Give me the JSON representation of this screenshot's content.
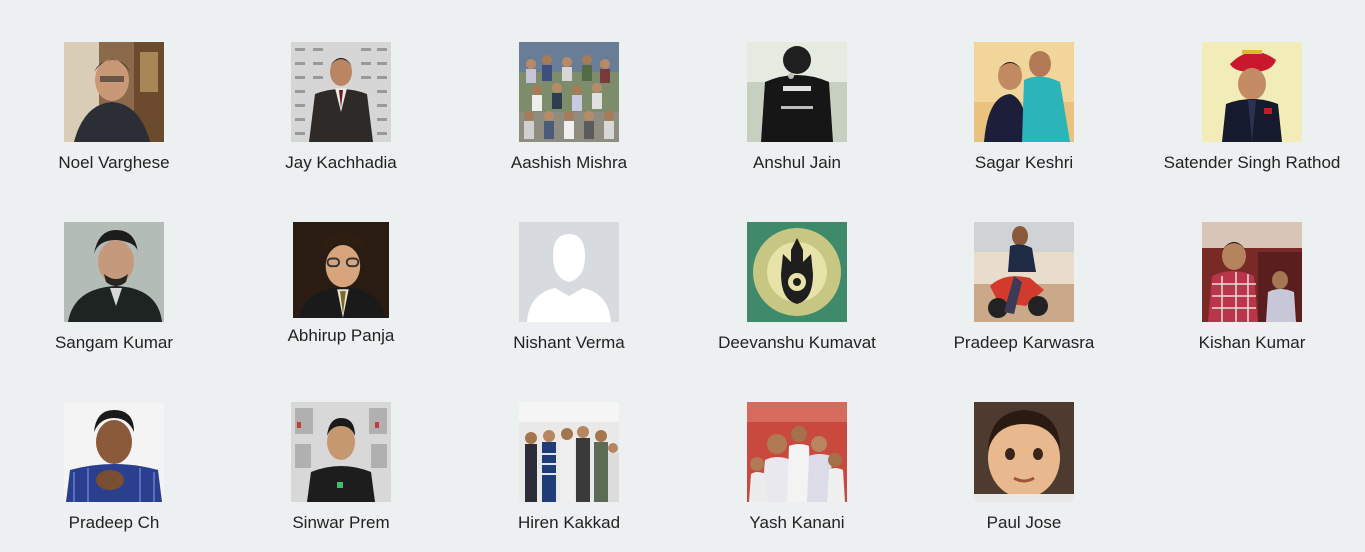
{
  "friends": [
    {
      "name": "Noel Varghese",
      "photo": "profile-photo"
    },
    {
      "name": "Jay Kachhadia",
      "photo": "profile-photo"
    },
    {
      "name": "Aashish Mishra",
      "photo": "group-photo"
    },
    {
      "name": "Anshul Jain",
      "photo": "profile-photo"
    },
    {
      "name": "Sagar Keshri",
      "photo": "profile-photo"
    },
    {
      "name": "Satender Singh Rathod",
      "photo": "profile-photo"
    },
    {
      "name": "Sangam Kumar",
      "photo": "profile-photo"
    },
    {
      "name": "Abhirup Panja",
      "photo": "profile-photo"
    },
    {
      "name": "Nishant Verma",
      "photo": "default-avatar-silhouette"
    },
    {
      "name": "Deevanshu Kumavat",
      "photo": "hamsa-art"
    },
    {
      "name": "Pradeep Karwasra",
      "photo": "profile-photo"
    },
    {
      "name": "Kishan Kumar",
      "photo": "profile-photo"
    },
    {
      "name": "Pradeep Ch",
      "photo": "profile-photo"
    },
    {
      "name": "Sinwar Prem",
      "photo": "profile-photo"
    },
    {
      "name": "Hiren Kakkad",
      "photo": "group-photo"
    },
    {
      "name": "Yash Kanani",
      "photo": "group-photo"
    },
    {
      "name": "Paul Jose",
      "photo": "profile-photo"
    }
  ],
  "colors": {
    "background": "#ecf0f1",
    "name_text": "#222222",
    "default_avatar_bg": "#d7dbe0",
    "default_avatar_fg": "#ffffff"
  }
}
